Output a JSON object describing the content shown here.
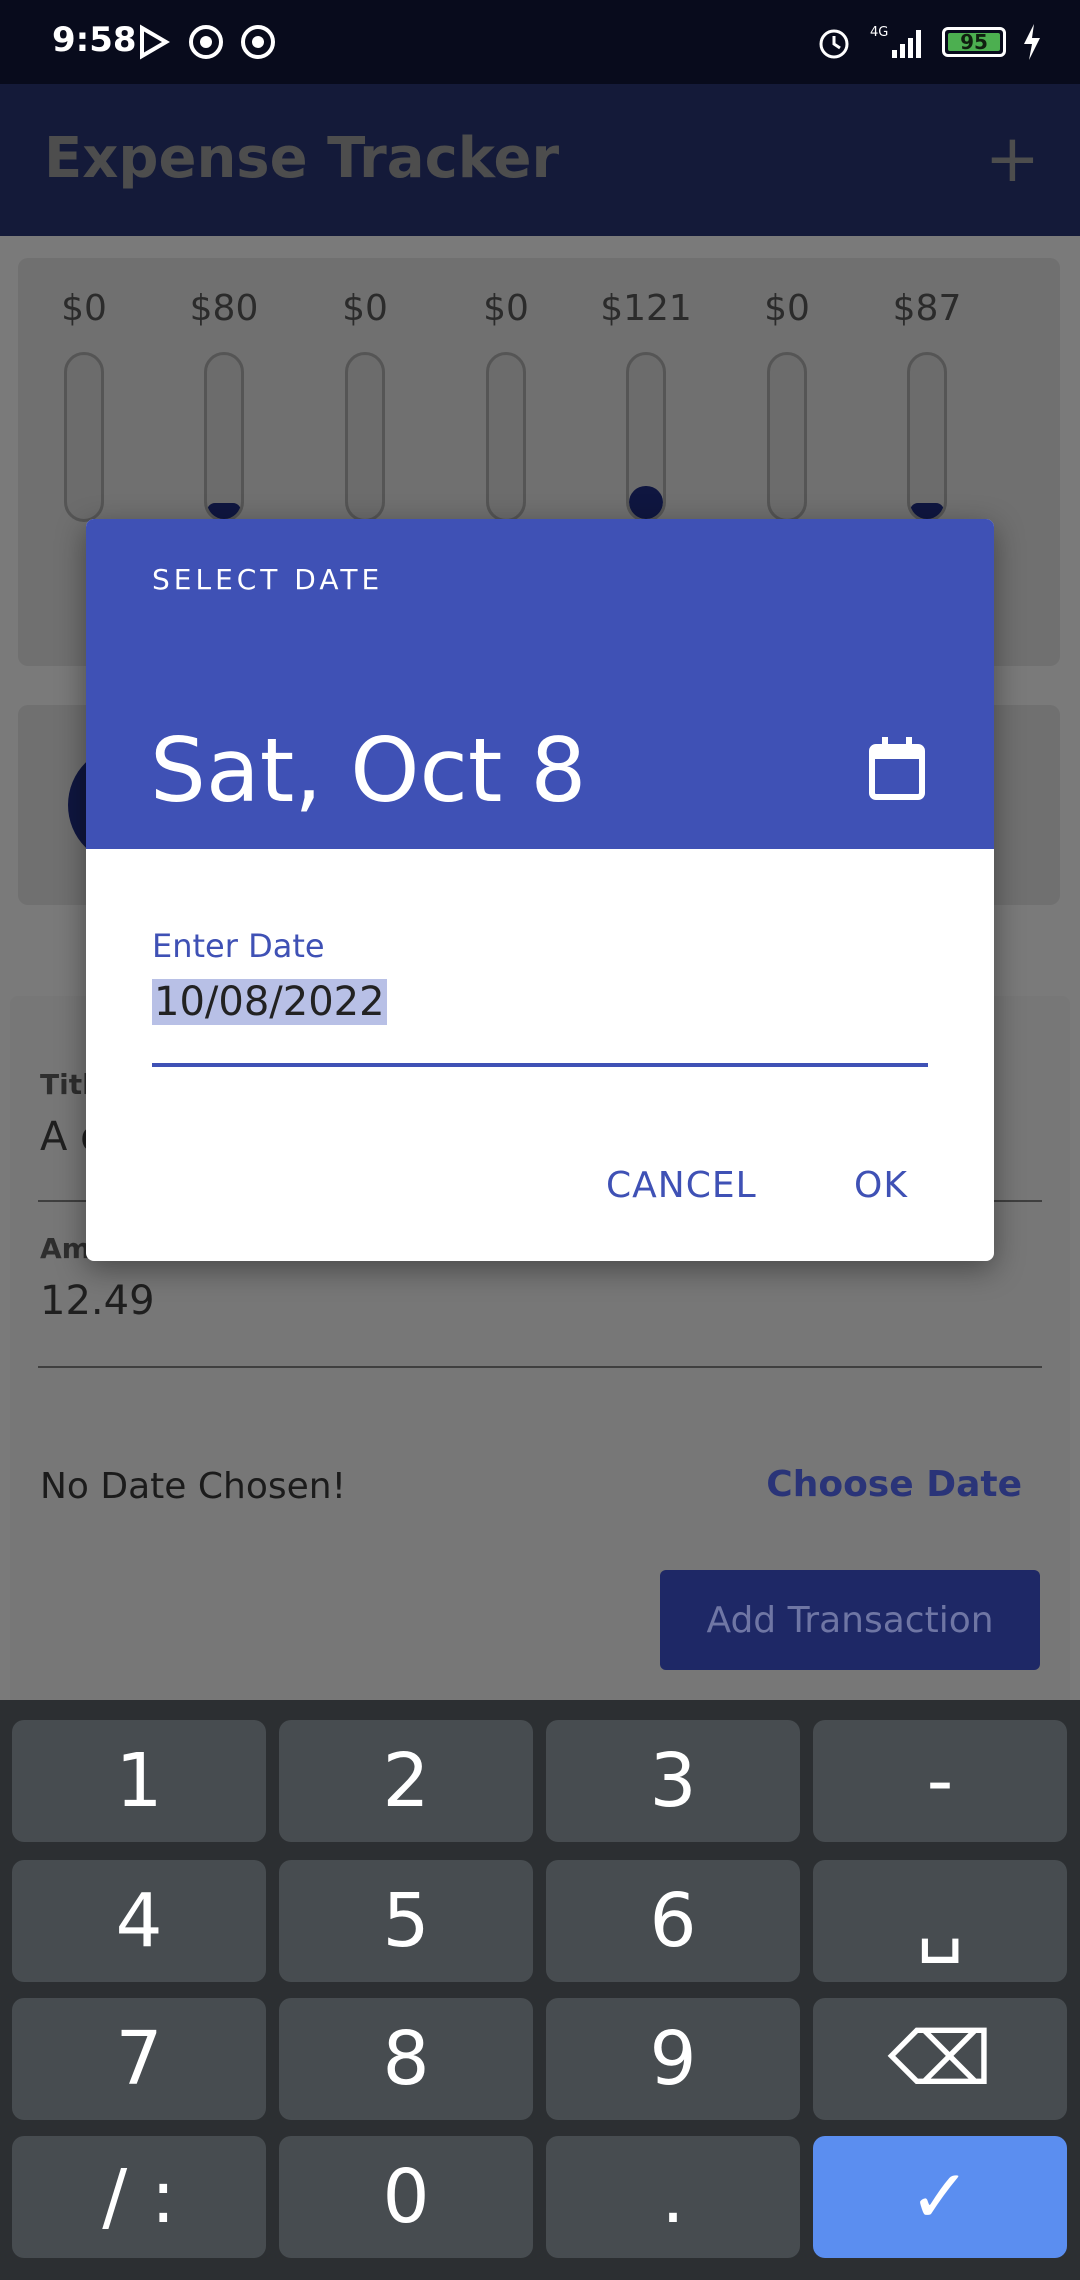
{
  "status_bar": {
    "time": "9:58",
    "left_icons": [
      "play-store-icon",
      "app-icon",
      "app-icon"
    ],
    "right_icons": [
      "alarm-icon",
      "signal-4g-icon",
      "battery-icon",
      "charging-icon"
    ],
    "network": "4G",
    "battery": "95"
  },
  "app_bar": {
    "title": "Expense Tracker",
    "add_icon": "+"
  },
  "chart": {
    "bars": [
      {
        "amount": "$0",
        "fill": 0.0
      },
      {
        "amount": "$80",
        "fill": 0.1
      },
      {
        "amount": "$0",
        "fill": 0.0
      },
      {
        "amount": "$0",
        "fill": 0.0
      },
      {
        "amount": "$121",
        "fill": 0.2
      },
      {
        "amount": "$0",
        "fill": 0.0
      },
      {
        "amount": "$87",
        "fill": 0.1
      }
    ]
  },
  "form": {
    "title_label": "Title",
    "title_value": "A d",
    "amount_label": "Amount",
    "amount_value": "12.49",
    "no_date_text": "No Date Chosen!",
    "choose_date": "Choose Date",
    "add_transaction": "Add Transaction"
  },
  "dialog": {
    "overline": "SELECT DATE",
    "headline_date": "Sat, Oct 8",
    "calendar_icon": "calendar-icon",
    "input_label": "Enter Date",
    "input_value": "10/08/2022",
    "cancel": "CANCEL",
    "ok": "OK",
    "accent_color": "#3f51b5"
  },
  "keyboard": {
    "keys": [
      "1",
      "2",
      "3",
      "-",
      "4",
      "5",
      "6",
      "␣",
      "7",
      "8",
      "9",
      "⌫",
      "/ :",
      "0",
      ".",
      "✓"
    ]
  }
}
